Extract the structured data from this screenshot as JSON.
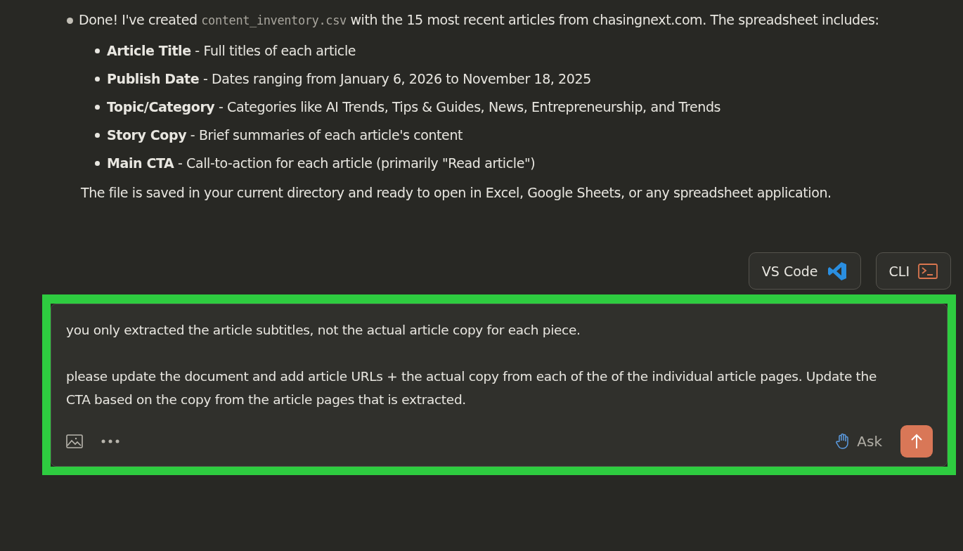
{
  "message": {
    "intro": "Done! I've created",
    "file_name": "content_inventory.csv",
    "intro_after": "with the 15 most recent articles from chasingnext.com. The spreadsheet includes:",
    "items": [
      {
        "term": "Article Title",
        "text": " - Full titles of each article"
      },
      {
        "term": "Publish Date",
        "text": " - Dates ranging from January 6, 2026 to November 18, 2025"
      },
      {
        "term": "Topic/Category",
        "text": " - Categories like AI Trends, Tips & Guides, News, Entrepreneurship, and Trends"
      },
      {
        "term": "Story Copy",
        "text": " - Brief summaries of each article's content"
      },
      {
        "term": "Main CTA",
        "text": " - Call-to-action for each article (primarily \"Read article\")"
      }
    ],
    "closing": "The file is saved in your current directory and ready to open in Excel, Google Sheets, or any spreadsheet application."
  },
  "open_in": [
    {
      "kind": "vscode",
      "label": "VS Code"
    },
    {
      "kind": "cli",
      "label": "CLI"
    }
  ],
  "composer": {
    "value": "you only extracted the article subtitles, not the actual article copy for each piece.\n\nplease update the document and add article URLs + the actual copy from each of the of the individual article pages. Update the CTA based on the copy from the article pages that is extracted.",
    "mode": "Ask",
    "highlighted": true
  }
}
